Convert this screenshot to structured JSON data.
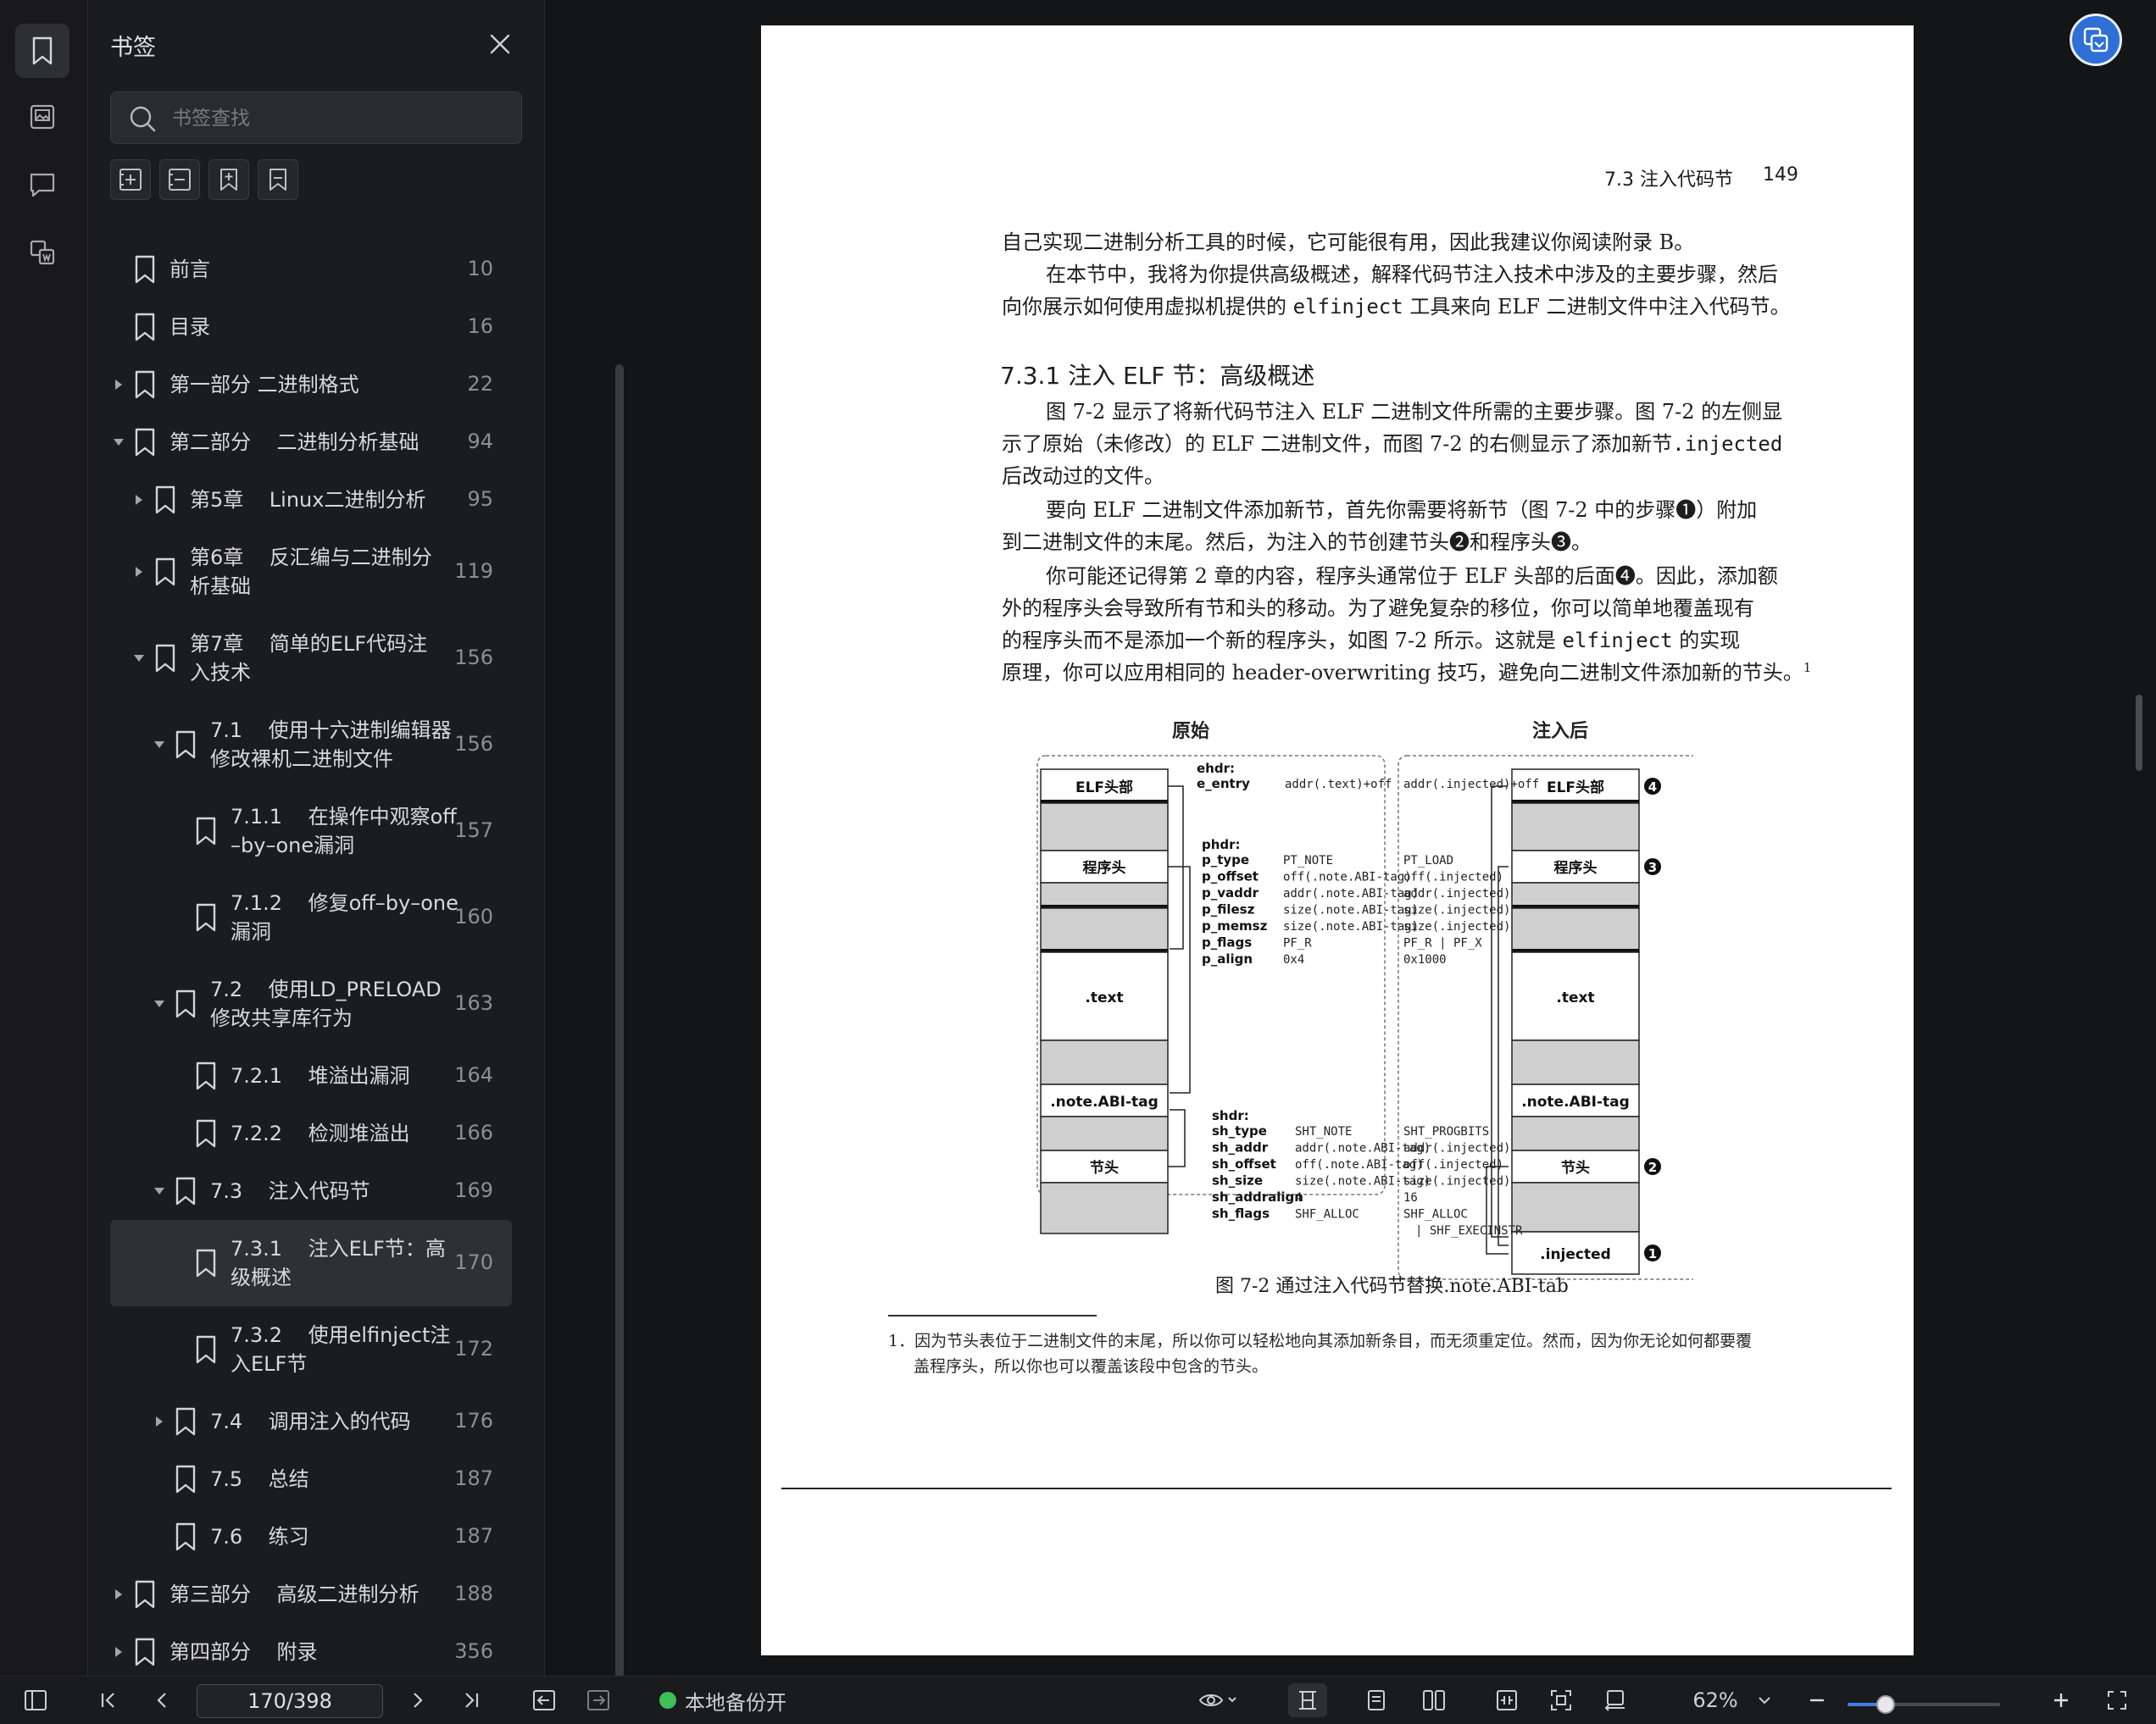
{
  "panel": {
    "title": "书签",
    "search_placeholder": "书签查找"
  },
  "bookmarks": [
    {
      "label": "前言",
      "page": "10"
    },
    {
      "label": "目录",
      "page": "16"
    },
    {
      "label": "第一部分 二进制格式",
      "page": "22"
    },
    {
      "label": "第二部分    二进制分析基础",
      "page": "94"
    },
    {
      "label": "第5章    Linux二进制分析",
      "page": "95"
    },
    {
      "label": "第6章    反汇编与二进制分\n析基础",
      "page": "119"
    },
    {
      "label": "第7章    简单的ELF代码注\n入技术",
      "page": "156"
    },
    {
      "label": "7.1    使用十六进制编辑器\n修改裸机二进制文件",
      "page": "156"
    },
    {
      "label": "7.1.1    在操作中观察off\n–by–one漏洞",
      "page": "157"
    },
    {
      "label": "7.1.2    修复off–by–one\n漏洞",
      "page": "160"
    },
    {
      "label": "7.2    使用LD_PRELOAD\n修改共享库行为",
      "page": "163"
    },
    {
      "label": "7.2.1    堆溢出漏洞",
      "page": "164"
    },
    {
      "label": "7.2.2    检测堆溢出",
      "page": "166"
    },
    {
      "label": "7.3    注入代码节",
      "page": "169"
    },
    {
      "label": "7.3.1    注入ELF节：高\n级概述",
      "page": "170"
    },
    {
      "label": "7.3.2    使用elfinject注\n入ELF节",
      "page": "172"
    },
    {
      "label": "7.4    调用注入的代码",
      "page": "176"
    },
    {
      "label": "7.5    总结",
      "page": "187"
    },
    {
      "label": "7.6    练习",
      "page": "187"
    },
    {
      "label": "第三部分    高级二进制分析",
      "page": "188"
    },
    {
      "label": "第四部分    附录",
      "page": "356"
    }
  ],
  "doc": {
    "header_section": "7.3    注入代码节",
    "header_page": "149",
    "p1": "自己实现二进制分析工具的时候，它可能很有用，因此我建议你阅读附录 B。",
    "p2a": "在本节中，我将为你提供高级概述，解释代码节注入技术中涉及的主要步骤，然后",
    "p2b_pre": "向你展示如何使用虚拟机提供的 ",
    "p2b_code": "elfinject",
    "p2b_post": " 工具来向 ELF 二进制文件中注入代码节。",
    "h": "7.3.1    注入 ELF 节：高级概述",
    "p3a": "图 7-2 显示了将新代码节注入 ELF 二进制文件所需的主要步骤。图 7-2 的左侧显",
    "p3b_pre": "示了原始（未修改）的 ELF 二进制文件，而图 7-2 的右侧显示了添加新节",
    "p3b_code": ".injected",
    "p3c": "后改动过的文件。",
    "p4a": "要向 ELF 二进制文件添加新节，首先你需要将新节（图 7-2 中的步骤❶）附加",
    "p4b": "到二进制文件的末尾。然后，为注入的节创建节头❷和程序头❸。",
    "p5a": "你可能还记得第 2 章的内容，程序头通常位于 ELF 头部的后面❹。因此，添加额",
    "p5b": "外的程序头会导致所有节和头的移动。为了避免复杂的移位，你可以简单地覆盖现有",
    "p5c_pre": "的程序头而不是添加一个新的程序头，如图 7-2 所示。这就是 ",
    "p5c_code": "elfinject",
    "p5c_post": " 的实现",
    "p5d": "原理，你可以应用相同的 header-overwriting 技巧，避免向二进制文件添加新的节头。",
    "p5d_sup": "1",
    "caption": "图 7-2    通过注入代码节替换.note.ABI-tab",
    "footnote1": "1．因为节头表位于二进制文件的末尾，所以你可以轻松地向其添加新条目，而无须重定位。然而，因为你无论如何都要覆",
    "footnote2": "盖程序头，所以你也可以覆盖该段中包含的节头。"
  },
  "figure": {
    "left_title": "原始",
    "right_title": "注入后",
    "blocks_left": [
      "ELF头部",
      "程序头",
      ".text",
      ".note.ABI-tag",
      "节头"
    ],
    "blocks_right": [
      "ELF头部",
      "程序头",
      ".text",
      ".note.ABI-tag",
      "节头",
      ".injected"
    ],
    "markers": [
      "4",
      "3",
      "2",
      "1"
    ],
    "ehdr": "ehdr:",
    "e_entry": "e_entry",
    "e_entry_l": "addr(.text)+off",
    "e_entry_r": "addr(.injected)+off",
    "phdr": "phdr:",
    "phdr_fields": [
      "p_type",
      "p_offset",
      "p_vaddr",
      "p_filesz",
      "p_memsz",
      "p_flags",
      "p_align"
    ],
    "phdr_left": [
      "PT_NOTE",
      "off(.note.ABI-tag)",
      "addr(.note.ABI-tag)",
      "size(.note.ABI-tag)",
      "size(.note.ABI-tag)",
      "PF_R",
      "0x4"
    ],
    "phdr_right": [
      "PT_LOAD",
      "off(.injected)",
      "addr(.injected)",
      "size(.injected)",
      "size(.injected)",
      "PF_R | PF_X",
      "0x1000"
    ],
    "shdr": "shdr:",
    "shdr_fields": [
      "sh_type",
      "sh_addr",
      "sh_offset",
      "sh_size",
      "sh_addralign",
      "sh_flags"
    ],
    "shdr_left": [
      "SHT_NOTE",
      "addr(.note.ABI-tag)",
      "off(.note.ABI-tag)",
      "size(.note.ABI-tag)",
      "4",
      "SHF_ALLOC"
    ],
    "shdr_right": [
      "SHT_PROGBITS",
      "addr(.injected)",
      "off(.injected)",
      "size(.injected)",
      "16",
      "SHF_ALLOC",
      "| SHF_EXECINSTR"
    ]
  },
  "statusbar": {
    "page_indicator": "170/398",
    "backup": "本地备份开",
    "zoom": "62%",
    "zoom_fraction": 0.25
  },
  "colors": {
    "accent": "#3f7ee8",
    "backup_dot": "#3fbf57"
  }
}
